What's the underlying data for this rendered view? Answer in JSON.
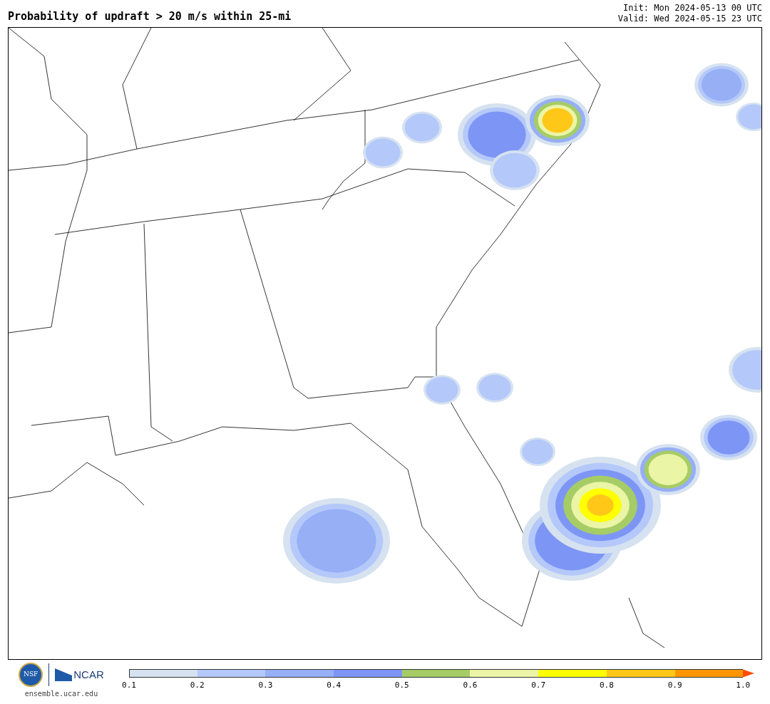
{
  "title": "Probability of updraft > 20 m/s within 25-mi",
  "init": "Init: Mon 2024-05-13 00 UTC",
  "valid": "Valid: Wed 2024-05-15 23 UTC",
  "logos": {
    "nsf": "NSF",
    "ncar": "NCAR",
    "url": "ensemble.ucar.edu"
  },
  "colorbar": {
    "bins": [
      {
        "color": "#d6e2f0"
      },
      {
        "color": "#b4c8fa"
      },
      {
        "color": "#96aff5"
      },
      {
        "color": "#7d96f5"
      },
      {
        "color": "#a6cc66"
      },
      {
        "color": "#ebf5a6"
      },
      {
        "color": "#ffff00"
      },
      {
        "color": "#ffc819"
      },
      {
        "color": "#ff9600"
      }
    ],
    "extend": {
      "color": "#ff4b00"
    },
    "ticks": [
      "0.1",
      "0.2",
      "0.3",
      "0.4",
      "0.5",
      "0.6",
      "0.7",
      "0.8",
      "0.9",
      "1.0"
    ]
  }
}
